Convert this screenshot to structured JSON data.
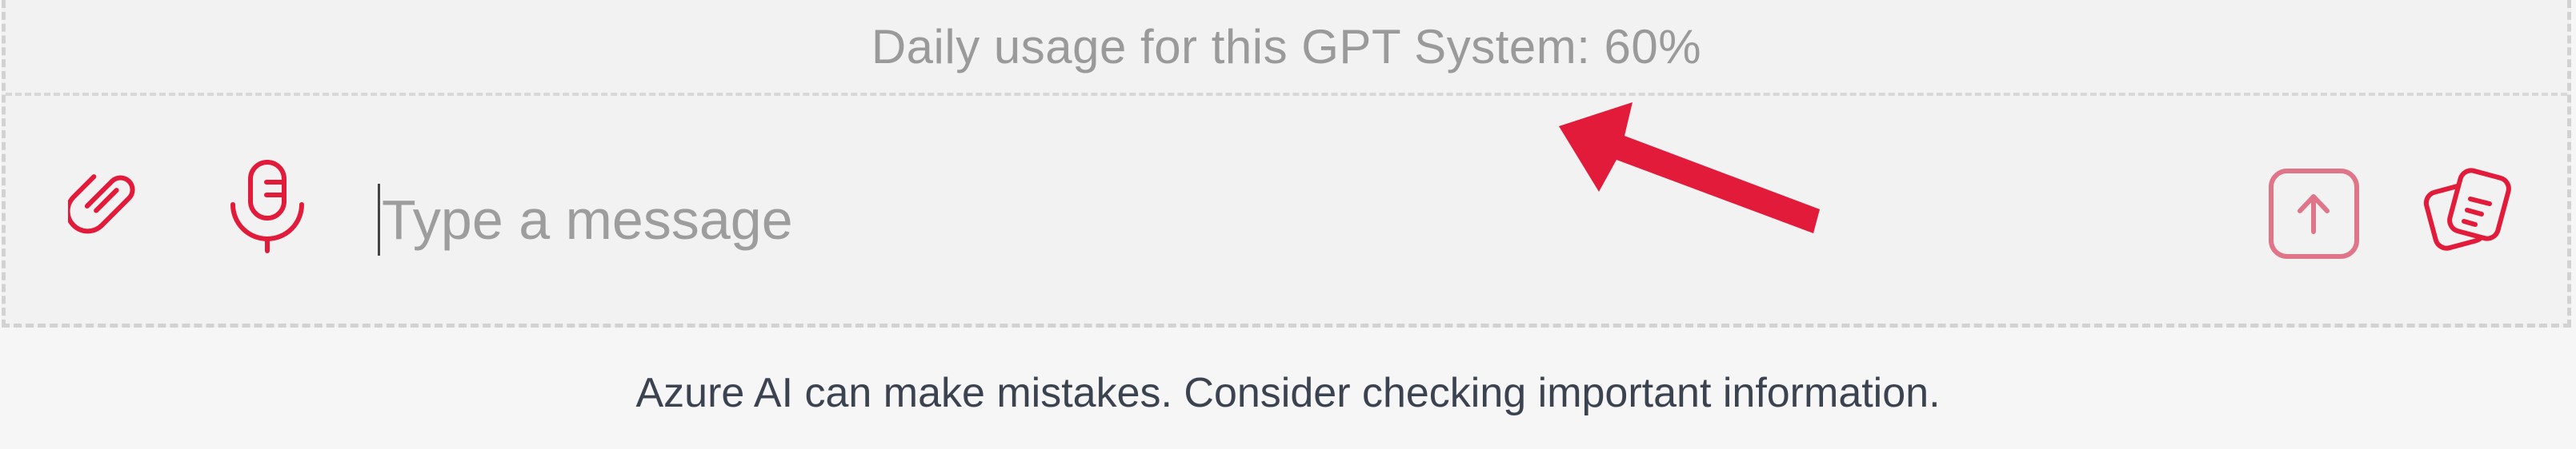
{
  "usage": {
    "text": "Daily usage for this GPT System: 60%",
    "percent": 60
  },
  "composer": {
    "placeholder": "Type a message",
    "value": "",
    "icons": {
      "attach": "paperclip-icon",
      "mic": "microphone-icon",
      "send": "arrow-up-icon",
      "prompts": "prompt-cards-icon"
    }
  },
  "footer": {
    "disclaimer": "Azure AI can make mistakes. Consider checking important information."
  },
  "colors": {
    "accent": "#e31b3b",
    "accent_muted": "#e07488",
    "annotation_arrow": "#e31b3b",
    "usage_text": "#9a9a9a",
    "footer_text": "#3c4350"
  }
}
